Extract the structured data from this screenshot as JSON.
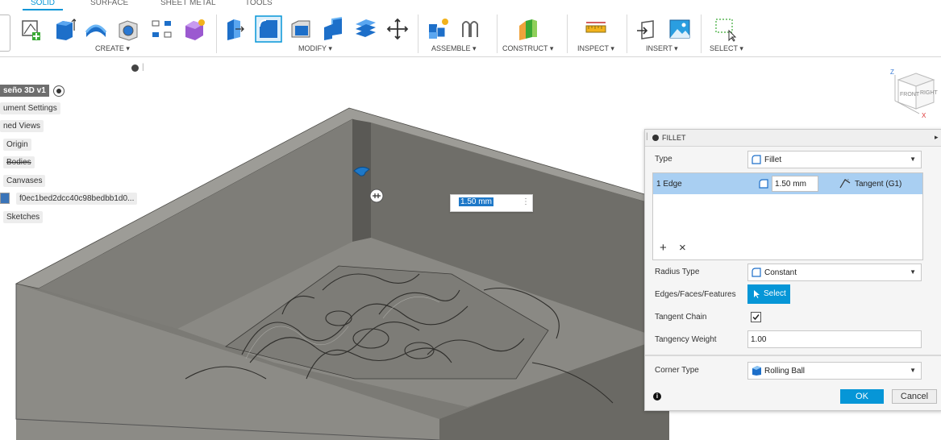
{
  "toolbar": {
    "tabs": [
      "SOLID",
      "SURFACE",
      "SHEET METAL",
      "TOOLS"
    ],
    "groups": {
      "create": "CREATE ▾",
      "modify": "MODIFY ▾",
      "assemble": "ASSEMBLE ▾",
      "construct": "CONSTRUCT ▾",
      "inspect": "INSPECT ▾",
      "insert": "INSERT ▾",
      "select": "SELECT ▾"
    }
  },
  "browser": {
    "root": "seño 3D v1",
    "items": [
      "ument Settings",
      "ned Views",
      "Origin",
      "Bodies",
      "Canvases",
      "f0ec1bed2dcc40c98bedbb1d0...",
      "Sketches"
    ]
  },
  "viewport": {
    "dimension_input": "1.50 mm"
  },
  "viewcube": {
    "front": "FRONT",
    "right": "RIGHT",
    "axis_z": "Z",
    "axis_x": "X"
  },
  "fillet": {
    "title": "FILLET",
    "type_label": "Type",
    "type_value": "Fillet",
    "edge_label": "1 Edge",
    "edge_radius": "1.50 mm",
    "edge_continuity": "Tangent (G1)",
    "add_symbol": "+",
    "remove_symbol": "×",
    "radius_type_label": "Radius Type",
    "radius_type_value": "Constant",
    "edges_label": "Edges/Faces/Features",
    "select_label": "Select",
    "tangent_chain_label": "Tangent Chain",
    "tangent_chain_checked": true,
    "tangency_weight_label": "Tangency Weight",
    "tangency_weight_value": "1.00",
    "corner_type_label": "Corner Type",
    "corner_type_value": "Rolling Ball",
    "ok": "OK",
    "cancel": "Cancel"
  },
  "colors": {
    "accent": "#0696d7",
    "selected_row": "#a9cff2",
    "model_dark": "#5c5b57",
    "model_light": "#9b9a95"
  }
}
